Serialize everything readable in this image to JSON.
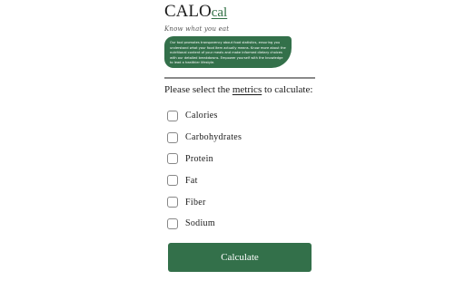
{
  "header": {
    "logo_main": "CALO",
    "logo_accent": "cal",
    "tagline": "Know what you eat"
  },
  "intro": {
    "text": "Our tool promotes transparency about food statistics, ensuring you understand what your food item actually means. Know more about the nutritional content of your meals and make informed dietary choices with our detailed breakdowns. Empower yourself with the knowledge to lead a healthier lifestyle."
  },
  "question": {
    "prefix": "Please select the ",
    "link": "metrics",
    "suffix": " to calculate:"
  },
  "options": [
    {
      "label": "Calories",
      "checked": false
    },
    {
      "label": "Carbohydrates",
      "checked": false
    },
    {
      "label": "Protein",
      "checked": false
    },
    {
      "label": "Fat",
      "checked": false
    },
    {
      "label": "Fiber",
      "checked": false
    },
    {
      "label": "Sodium",
      "checked": false
    }
  ],
  "actions": {
    "calculate_label": "Calculate"
  },
  "colors": {
    "accent": "#33704a",
    "divider": "#8a8a8a"
  }
}
